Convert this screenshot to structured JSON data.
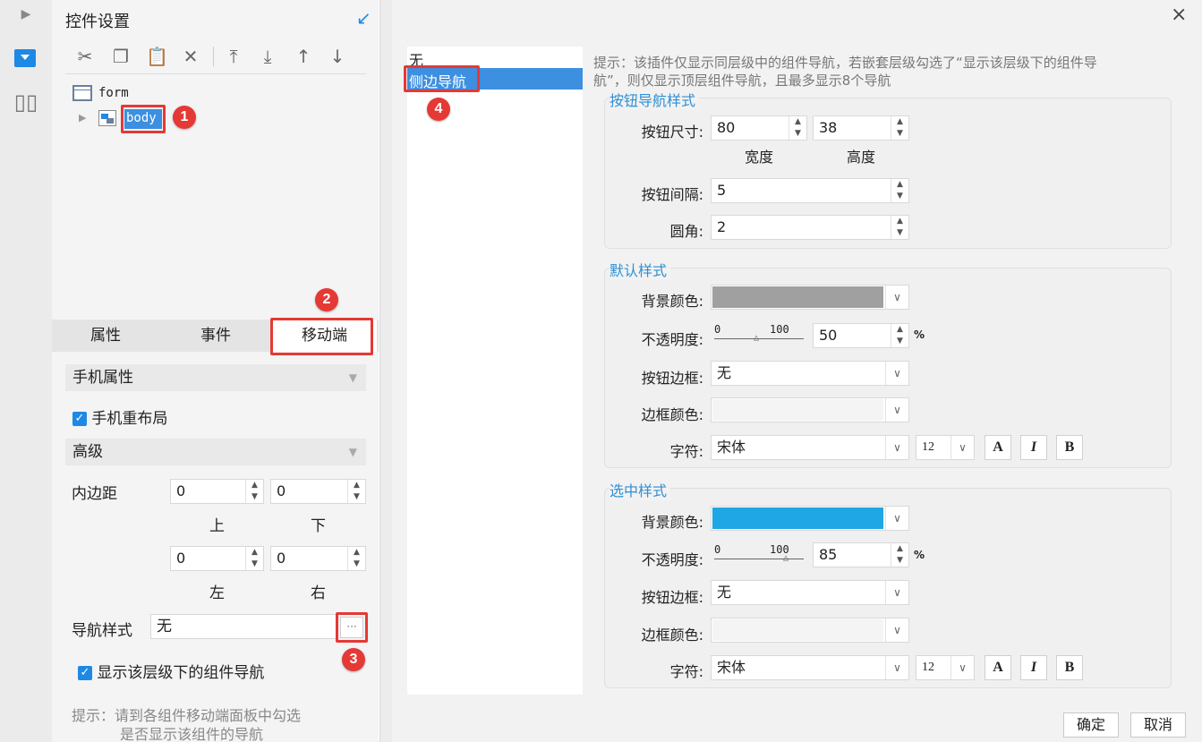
{
  "left_panel": {
    "title": "控件设置",
    "tree": {
      "root": "form",
      "child": "body"
    },
    "tabs": [
      "属性",
      "事件",
      "移动端"
    ],
    "phone_props_header": "手机属性",
    "phone_relayout_label": "手机重布局",
    "advanced_header": "高级",
    "padding": {
      "label": "内边距",
      "top": "0",
      "bottom": "0",
      "left": "0",
      "right": "0",
      "top_label": "上",
      "bottom_label": "下",
      "left_label": "左",
      "right_label": "右"
    },
    "nav_style": {
      "label": "导航样式",
      "value": "无",
      "more": "···"
    },
    "show_nav_label": "显示该层级下的组件导航",
    "hint": [
      "提示：请到各组件移动端面板中勾选",
      "是否显示该组件的导航"
    ]
  },
  "badges": [
    "1",
    "2",
    "3",
    "4"
  ],
  "dialog": {
    "close": "×",
    "list": [
      "无",
      "侧边导航"
    ],
    "hint": [
      "提示：该插件仅显示同层级中的组件导航，若嵌套层级勾选了“显示该层级下的组件导",
      "航”，则仅显示顶层组件导航，且最多显示8个导航"
    ],
    "button_style": {
      "title": "按钮导航样式",
      "size_label": "按钮尺寸:",
      "width": "80",
      "height": "38",
      "width_label": "宽度",
      "height_label": "高度",
      "gap_label": "按钮间隔:",
      "gap": "5",
      "radius_label": "圆角:",
      "radius": "2"
    },
    "default_style": {
      "title": "默认样式",
      "bg_label": "背景颜色:",
      "bg_color": "#a0a0a0",
      "opacity_label": "不透明度:",
      "slider_min": "0",
      "slider_max": "100",
      "opacity": "50",
      "percent": "%",
      "border_label": "按钮边框:",
      "border": "无",
      "border_color_label": "边框颜色:",
      "font_label": "字符:",
      "font": "宋体",
      "font_size": "12"
    },
    "selected_style": {
      "title": "选中样式",
      "bg_label": "背景颜色:",
      "bg_color": "#1ea7e4",
      "opacity_label": "不透明度:",
      "slider_min": "0",
      "slider_max": "100",
      "opacity": "85",
      "percent": "%",
      "border_label": "按钮边框:",
      "border": "无",
      "border_color_label": "边框颜色:",
      "font_label": "字符:",
      "font": "宋体",
      "font_size": "12"
    },
    "font_buttons": [
      "A",
      "I",
      "B"
    ],
    "ok": "确定",
    "cancel": "取消"
  }
}
